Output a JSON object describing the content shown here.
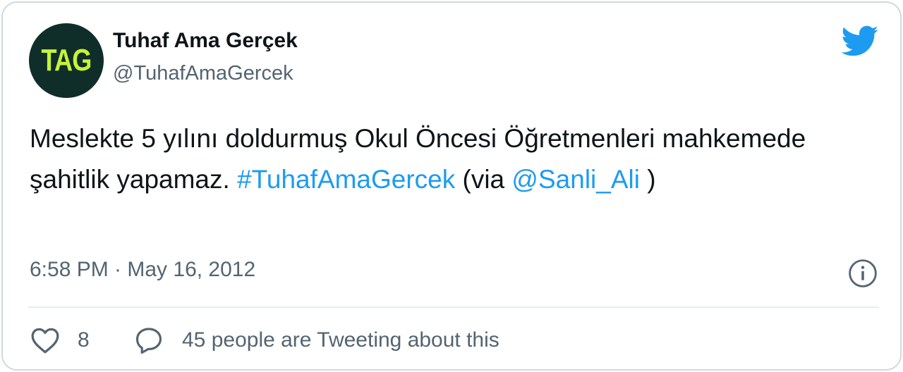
{
  "author": {
    "avatar_text": "TAG",
    "name": "Tuhaf Ama Gerçek",
    "handle": "@TuhafAmaGercek"
  },
  "tweet": {
    "text_part1": "Meslekte 5 yılını doldurmuş Okul Öncesi Öğretmenleri mahkemede şahitlik yapamaz. ",
    "hashtag": "#TuhafAmaGercek",
    "text_part2": " (via ",
    "mention": "@Sanli_Ali",
    "text_part3": " )",
    "timestamp": "6:58 PM · May 16, 2012"
  },
  "actions": {
    "like_count": "8",
    "reply_text": "45 people are Tweeting about this"
  },
  "icons": {
    "brand": "twitter-bird-icon",
    "info": "info-icon",
    "like": "heart-icon",
    "reply": "speech-bubble-icon"
  },
  "colors": {
    "accent": "#1d9bf0",
    "text": "#0f1419",
    "secondary": "#536471",
    "border": "#cfd9de",
    "avatar_bg": "#0f2e2a",
    "avatar_text": "#c7f23a"
  }
}
